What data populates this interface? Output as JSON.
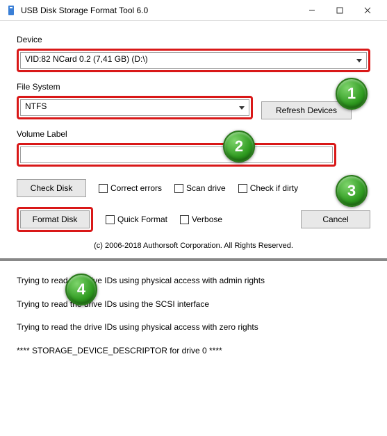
{
  "window": {
    "title": "USB Disk Storage Format Tool 6.0"
  },
  "labels": {
    "device": "Device",
    "file_system": "File System",
    "volume_label": "Volume Label"
  },
  "fields": {
    "device_value": "VID:82  NCard  0.2 (7,41 GB) (D:\\)",
    "fs_value": "NTFS",
    "volume_value": ""
  },
  "buttons": {
    "refresh": "Refresh Devices",
    "check_disk": "Check Disk",
    "format_disk": "Format Disk",
    "cancel": "Cancel"
  },
  "checkboxes": {
    "correct_errors": "Correct errors",
    "scan_drive": "Scan drive",
    "check_if_dirty": "Check if dirty",
    "quick_format": "Quick Format",
    "verbose": "Verbose"
  },
  "copyright": "(c) 2006-2018 Authorsoft Corporation. All Rights Reserved.",
  "log": {
    "l1": "Trying to read the drive IDs using physical access with admin rights",
    "l2": "Trying to read the drive IDs using the SCSI interface",
    "l3": "Trying to read the drive IDs using physical access with zero rights",
    "l4": "**** STORAGE_DEVICE_DESCRIPTOR for drive 0 ****"
  },
  "badges": {
    "b1": "1",
    "b2": "2",
    "b3": "3",
    "b4": "4"
  }
}
